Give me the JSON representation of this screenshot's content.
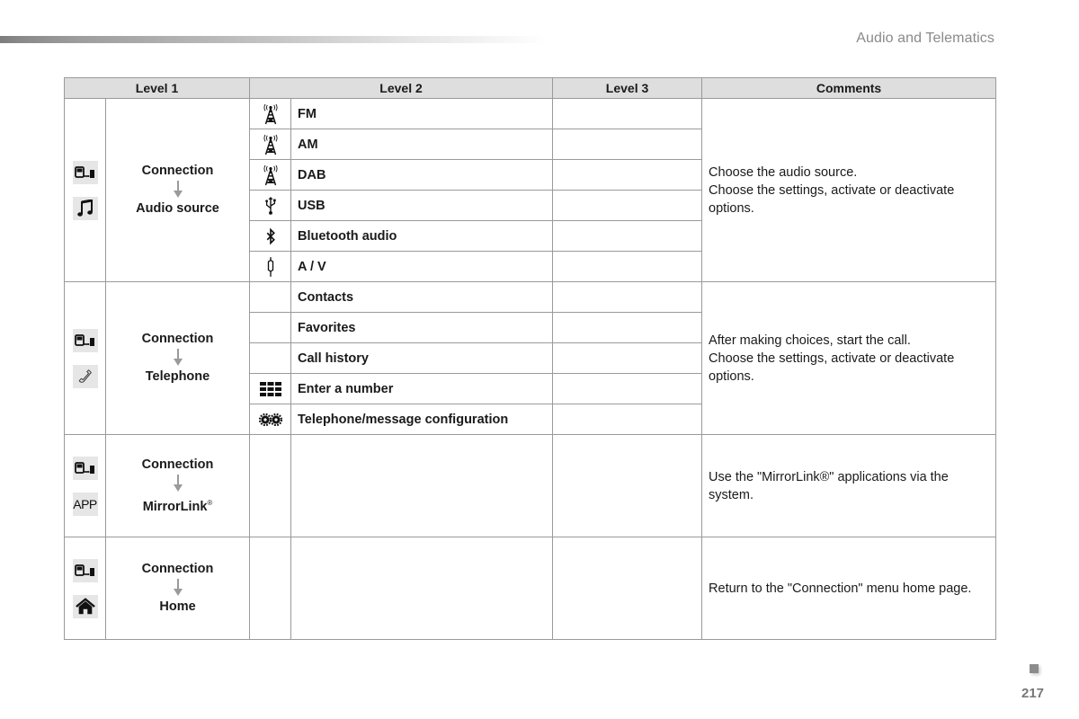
{
  "header": {
    "section_title": "Audio and Telematics"
  },
  "table": {
    "columns": [
      "Level 1",
      "Level 2",
      "Level 3",
      "Comments"
    ],
    "groups": [
      {
        "level1_icons": [
          "connection-icon",
          "music-note-icon"
        ],
        "level1_from": "Connection",
        "level1_to": "Audio source",
        "level2": [
          {
            "icon": "radio-antenna-icon",
            "label": "FM",
            "level3": ""
          },
          {
            "icon": "radio-antenna-icon",
            "label": "AM",
            "level3": ""
          },
          {
            "icon": "radio-antenna-icon",
            "label": "DAB",
            "level3": ""
          },
          {
            "icon": "usb-icon",
            "label": "USB",
            "level3": ""
          },
          {
            "icon": "bluetooth-icon",
            "label": "Bluetooth audio",
            "level3": ""
          },
          {
            "icon": "jack-plug-icon",
            "label": "A / V",
            "level3": ""
          }
        ],
        "comments": [
          "Choose the audio source.",
          "Choose the settings, activate or deactivate options."
        ]
      },
      {
        "level1_icons": [
          "connection-icon",
          "telephone-handset-icon"
        ],
        "level1_from": "Connection",
        "level1_to": "Telephone",
        "level2": [
          {
            "icon": "",
            "label": "Contacts",
            "level3": ""
          },
          {
            "icon": "",
            "label": "Favorites",
            "level3": ""
          },
          {
            "icon": "",
            "label": "Call history",
            "level3": ""
          },
          {
            "icon": "keypad-icon",
            "label": "Enter a number",
            "level3": ""
          },
          {
            "icon": "gears-icon",
            "label": "Telephone/message configuration",
            "level3": ""
          }
        ],
        "comments": [
          "After making choices, start the call.",
          "Choose the settings, activate or deactivate options."
        ]
      },
      {
        "level1_icons": [
          "connection-icon",
          "app-icon"
        ],
        "level1_from": "Connection",
        "level1_to": "MirrorLink",
        "level1_to_sup": "®",
        "app_icon_label": "APP",
        "comments": [
          "Use the \"MirrorLink®\" applications via the system."
        ]
      },
      {
        "level1_icons": [
          "connection-icon",
          "home-icon"
        ],
        "level1_from": "Connection",
        "level1_to": "Home",
        "comments": [
          "Return to the \"Connection\" menu home page."
        ]
      }
    ]
  },
  "footer": {
    "page_number": "217"
  }
}
